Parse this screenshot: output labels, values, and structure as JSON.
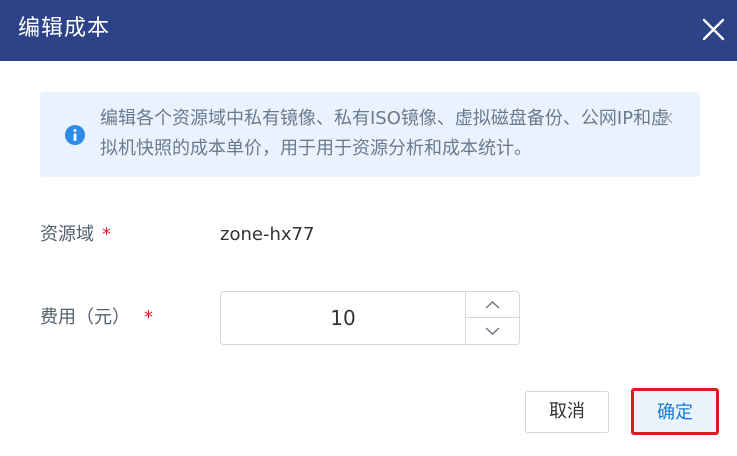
{
  "dialog": {
    "title": "编辑成本",
    "alert": {
      "message": "编辑各个资源域中私有镜像、私有ISO镜像、虚拟磁盘备份、公网IP和虚拟机快照的成本单价，用于用于资源分析和成本统计。"
    },
    "fields": {
      "zone": {
        "label": "资源域",
        "required_mark": "*",
        "value": "zone-hx77"
      },
      "cost": {
        "label": "费用（元）",
        "required_mark": "*",
        "value": "10"
      }
    },
    "buttons": {
      "cancel": "取消",
      "confirm": "确定"
    }
  },
  "colors": {
    "header_bg": "#2c4487",
    "alert_bg": "#eaf3fd",
    "info_icon": "#2d8ce8",
    "required": "#e02020",
    "confirm_text": "#1a7bd6",
    "highlight_border": "#e0191f"
  },
  "icons": {
    "close": "close-icon",
    "info": "info-icon",
    "alert_close": "close-icon",
    "increment": "chevron-up-icon",
    "decrement": "chevron-down-icon"
  }
}
